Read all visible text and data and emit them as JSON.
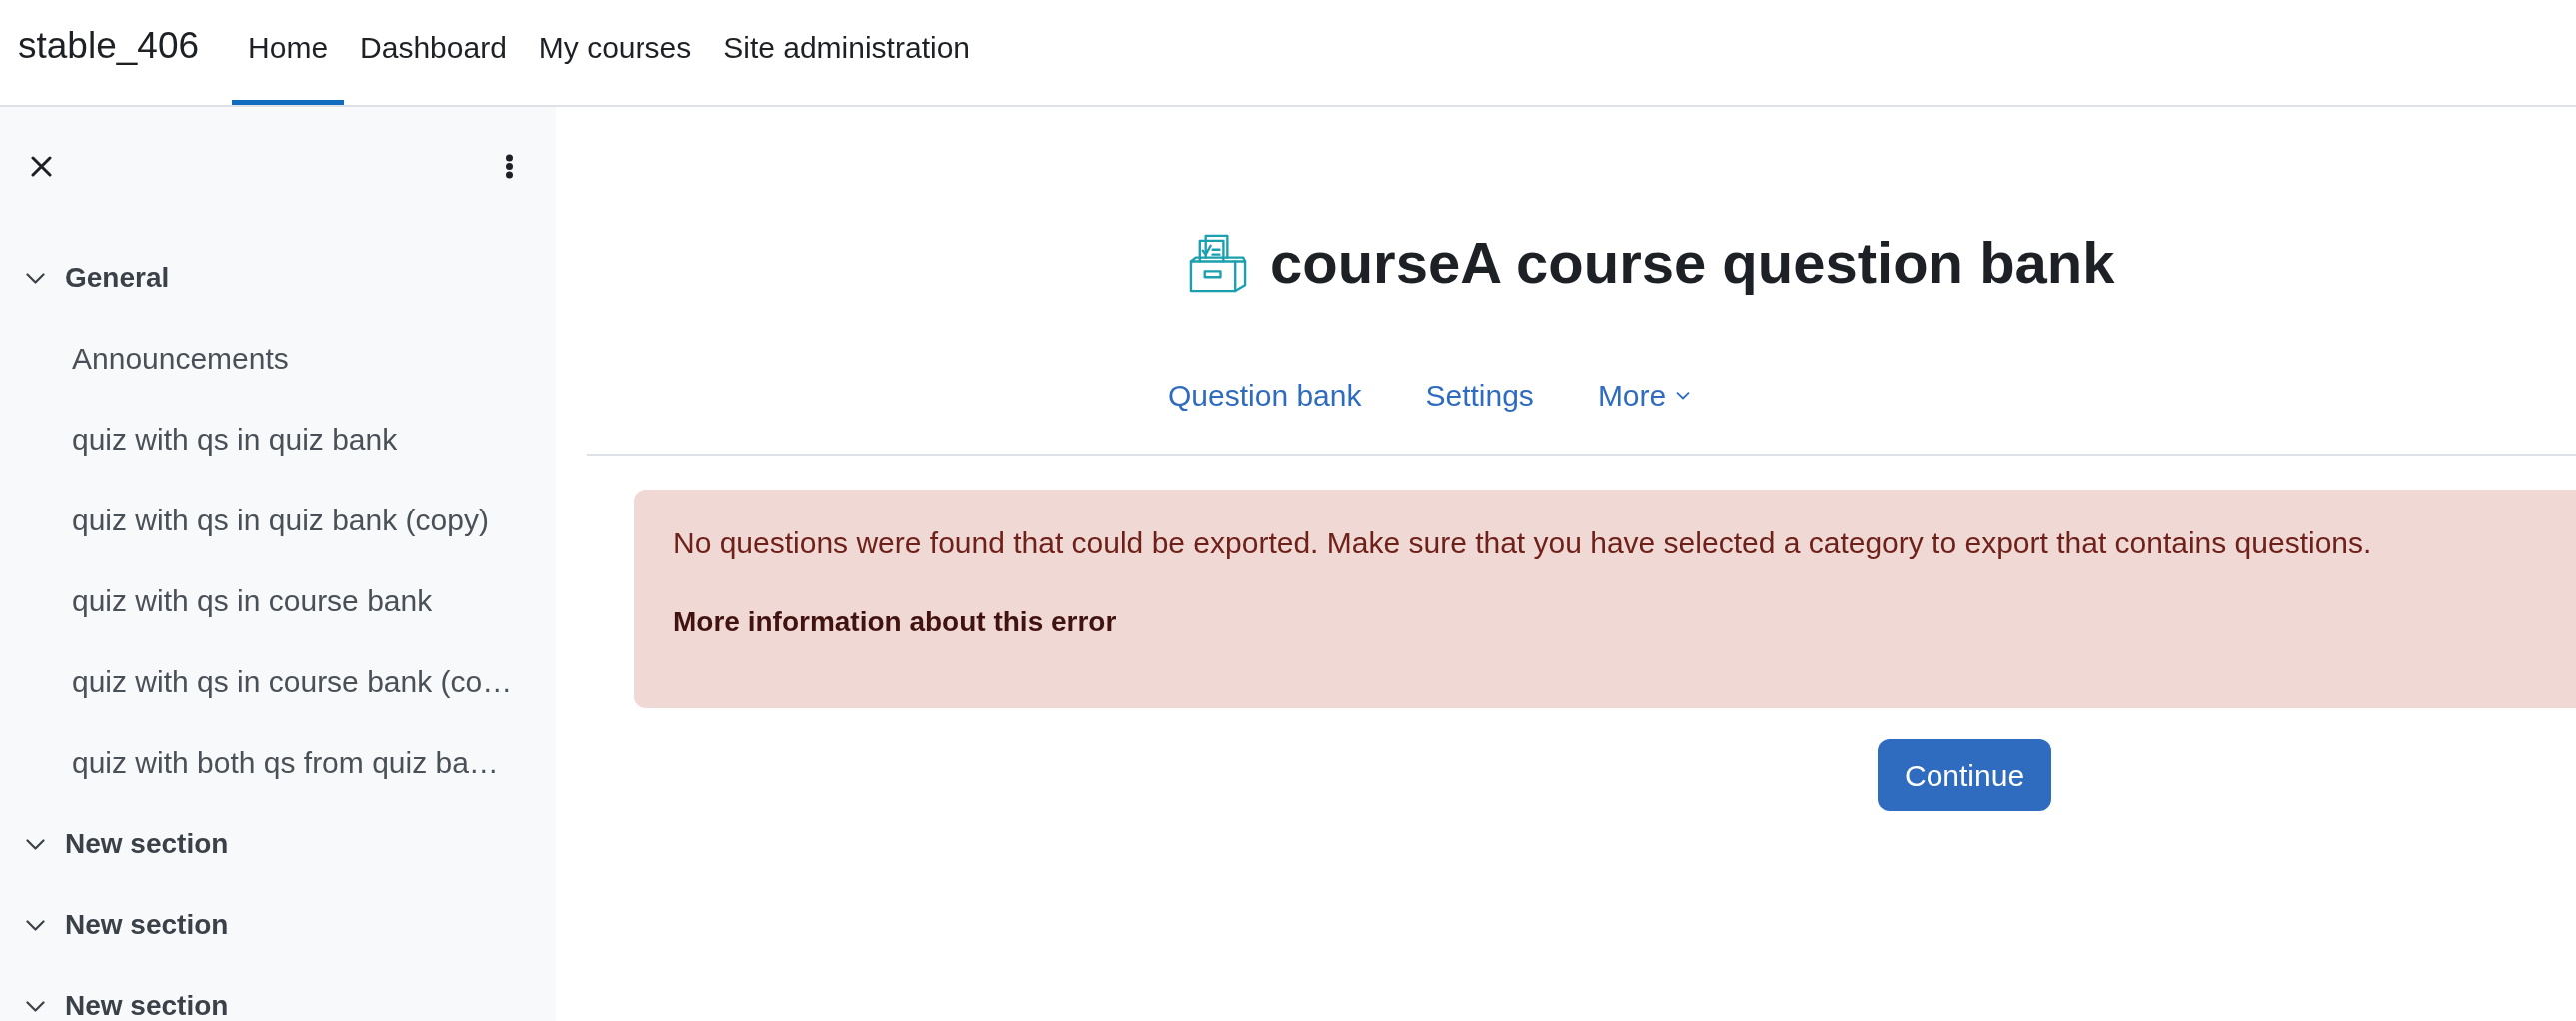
{
  "navbar": {
    "brand": "stable_406",
    "items": [
      {
        "label": "Home",
        "selected": true
      },
      {
        "label": "Dashboard",
        "selected": false
      },
      {
        "label": "My courses",
        "selected": false
      },
      {
        "label": "Site administration",
        "selected": false
      }
    ]
  },
  "course_index": {
    "sections": [
      {
        "title": "General",
        "expanded": true,
        "children": [
          {
            "label": "Announcements"
          },
          {
            "label": "quiz with qs in quiz bank"
          },
          {
            "label": "quiz with qs in quiz bank (copy)"
          },
          {
            "label": "quiz with qs in course bank"
          },
          {
            "label": "quiz with qs in course bank (co…"
          },
          {
            "label": "quiz with both qs from quiz ba…"
          }
        ]
      },
      {
        "title": "New section",
        "expanded": true
      },
      {
        "title": "New section",
        "expanded": true
      },
      {
        "title": "New section",
        "expanded": true
      }
    ]
  },
  "page_header": {
    "title": "courseA course question bank"
  },
  "secondary_nav": [
    {
      "label": "Question bank",
      "kind": "link",
      "selected": false
    },
    {
      "label": "Settings",
      "kind": "link",
      "selected": false
    },
    {
      "label": "More",
      "kind": "dropdown",
      "selected": false
    }
  ],
  "alert": {
    "message": "No questions were found that could be exported. Make sure that you have selected a category to export that contains questions.",
    "link": "More information about this error"
  },
  "continue_button": {
    "label": "Continue"
  }
}
